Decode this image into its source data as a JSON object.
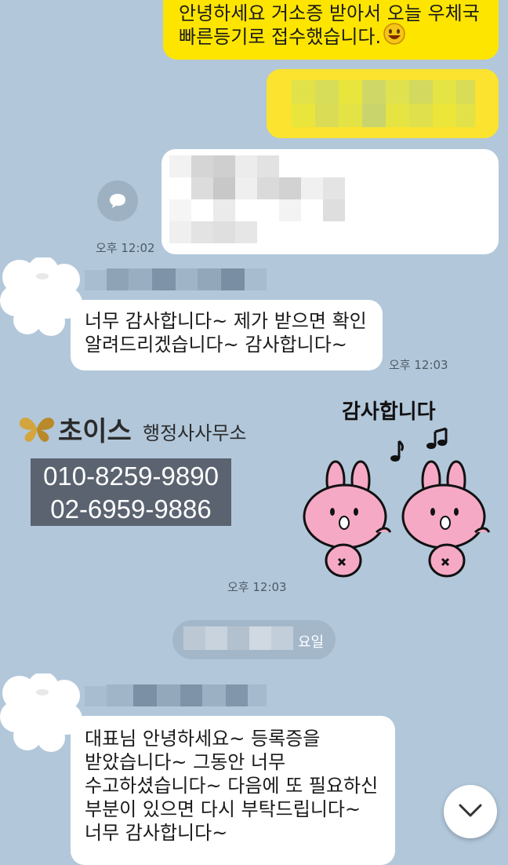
{
  "messages": {
    "m1_text": "안녕하세요 거소증 받아서 오늘 우체국\n빠른등기로 접수했습니다.",
    "m1_emoji": "smiling-face-emoji",
    "time_1": "오후 12:02",
    "m2_text": "너무 감사합니다~ 제가 받으면 확인\n알려드리겠습니다~ 감사합니다~",
    "time_2": "오후 12:03",
    "time_3": "오후 12:03",
    "m3_text": "   대표님 안녕하세요~ 등록증을\n받았습니다~ 그동안 너무\n수고하셨습니다~ 다음에 또 필요하신\n부분이 있으면 다시 부탁드립니다~\n너무 감사합니다~"
  },
  "card": {
    "brand": "초이스",
    "office": "행정사사무소",
    "phone1": "010-8259-9890",
    "phone2": "02-6959-9886"
  },
  "sticker": {
    "caption": "감사합니다",
    "icon": "two-pink-rabbits-sticker"
  },
  "date_divider": {
    "suffix": "요일"
  },
  "colors": {
    "background": "#b2c7da",
    "my_bubble": "#fee500",
    "other_bubble": "#ffffff",
    "phone_box": "#5b6370"
  },
  "icons": {
    "share": "share-chat-icon",
    "scroll": "chevron-down-icon"
  }
}
